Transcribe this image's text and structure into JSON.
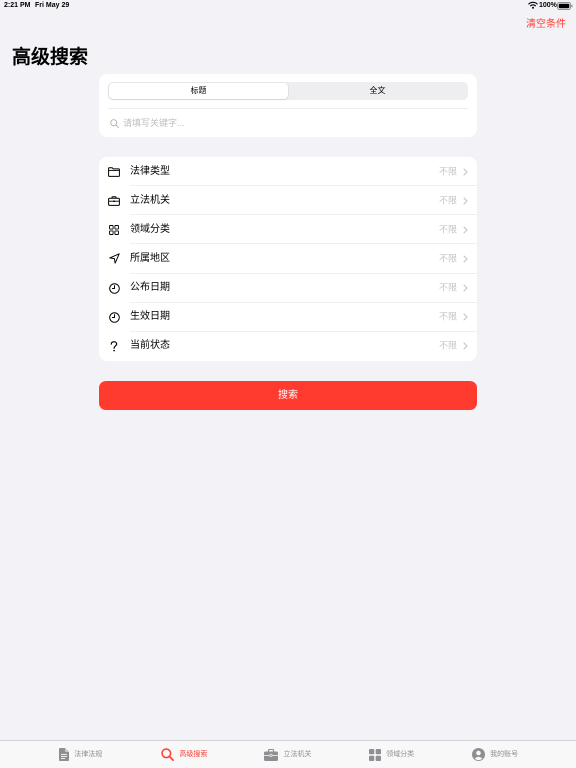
{
  "status_bar": {
    "time": "2:21 PM",
    "date": "Fri May 29",
    "battery": "100%",
    "icons": [
      "wifi-icon",
      "battery-icon"
    ]
  },
  "nav": {
    "clear_label": "清空条件"
  },
  "page": {
    "title": "高级搜索"
  },
  "search_card": {
    "segments": [
      {
        "label": "标题",
        "selected": true
      },
      {
        "label": "全文",
        "selected": false
      }
    ],
    "search_icon": "magnifier-icon",
    "placeholder": "请填写关键字..."
  },
  "filters": [
    {
      "icon": "folder-icon",
      "label": "法律类型",
      "value": "不限"
    },
    {
      "icon": "briefcase-icon",
      "label": "立法机关",
      "value": "不限"
    },
    {
      "icon": "grid-icon",
      "label": "领域分类",
      "value": "不限"
    },
    {
      "icon": "location-arrow-icon",
      "label": "所属地区",
      "value": "不限"
    },
    {
      "icon": "clock-icon",
      "label": "公布日期",
      "value": "不限"
    },
    {
      "icon": "clock-icon",
      "label": "生效日期",
      "value": "不限"
    },
    {
      "icon": "question-mark-icon",
      "label": "当前状态",
      "value": "不限"
    }
  ],
  "search_button": {
    "label": "搜索"
  },
  "tab_bar": {
    "items": [
      {
        "icon": "document-icon",
        "label": "法律法规",
        "selected": false
      },
      {
        "icon": "search-icon",
        "label": "高级搜索",
        "selected": true
      },
      {
        "icon": "briefcase-icon",
        "label": "立法机关",
        "selected": false
      },
      {
        "icon": "grid-icon",
        "label": "领域分类",
        "selected": false
      },
      {
        "icon": "person-circle-icon",
        "label": "我的账号",
        "selected": false
      }
    ]
  },
  "colors": {
    "accent": "#FF3B30",
    "background": "#F2F2F7",
    "card": "#FFFFFF",
    "secondary_text": "#C5C5C7",
    "tab_inactive": "#8E8E93"
  }
}
